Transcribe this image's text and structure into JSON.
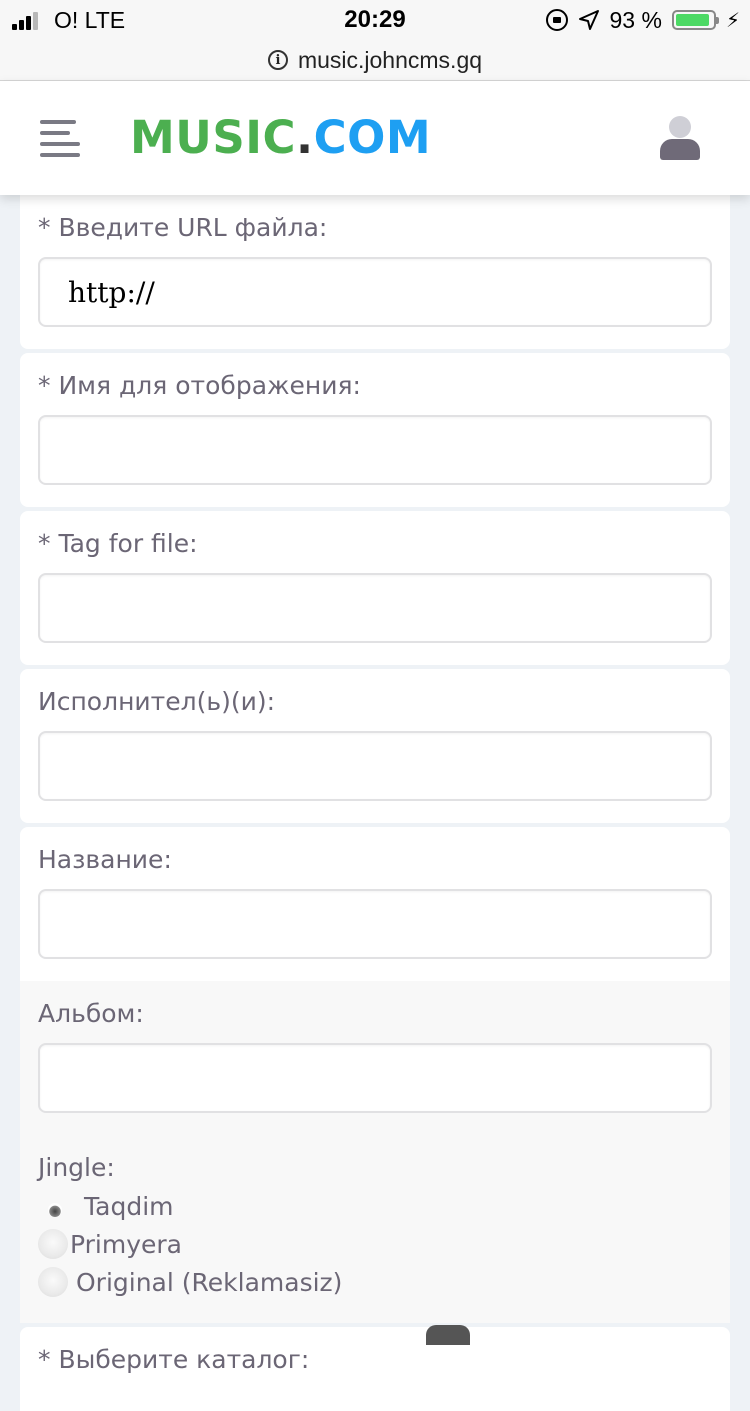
{
  "status_bar": {
    "carrier": "O!  LTE",
    "time": "20:29",
    "battery": "93 %",
    "battery_level": 0.93
  },
  "browser": {
    "url": "music.johncms.gq"
  },
  "header": {
    "logo_part1": "MUSIC",
    "logo_dot": ".",
    "logo_part2": "COM"
  },
  "form": {
    "url_field": {
      "label": "Введите URL файла:",
      "required": "*",
      "value": "http://"
    },
    "display_name": {
      "label": "Имя для отображения:",
      "required": "*",
      "value": ""
    },
    "tag": {
      "label": "Tag for file:",
      "required": "*",
      "value": ""
    },
    "artist": {
      "label": "Исполнител(ь)(и):",
      "value": ""
    },
    "title": {
      "label": "Название:",
      "value": ""
    },
    "album": {
      "label": "Альбом:",
      "value": ""
    },
    "jingle": {
      "label": "Jingle:",
      "options": [
        "Taqdim",
        "Primyera",
        "Original (Reklamasiz)"
      ],
      "selected": "Taqdim"
    },
    "catalog": {
      "label": "Выберите каталог:",
      "required": "*"
    }
  }
}
